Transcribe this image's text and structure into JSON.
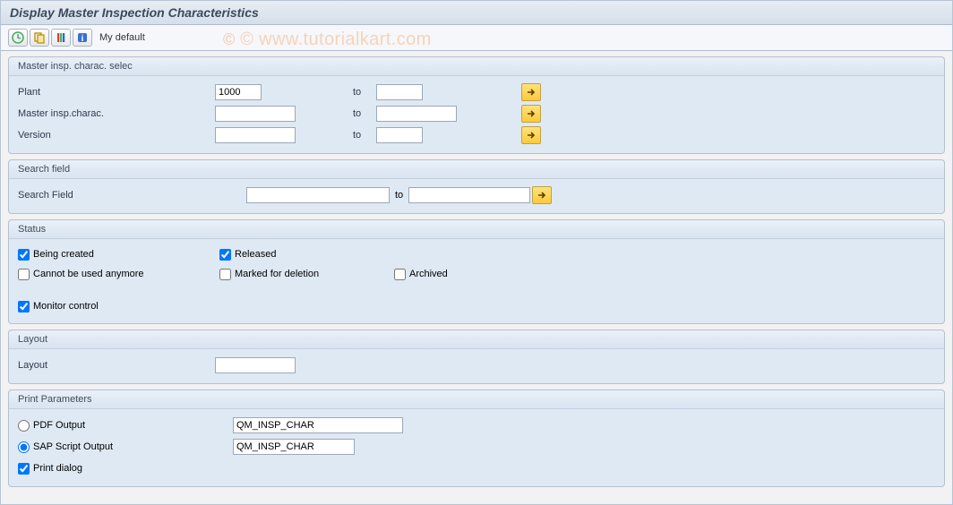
{
  "title": "Display Master Inspection Characteristics",
  "toolbar": {
    "my_default": "My default"
  },
  "watermark": "© www.tutorialkart.com",
  "group1": {
    "title": "Master insp. charac. selec",
    "plant_label": "Plant",
    "plant_value": "1000",
    "mic_label": "Master insp.charac.",
    "version_label": "Version",
    "to_label": "to"
  },
  "group2": {
    "title": "Search field",
    "search_label": "Search Field",
    "to_label": "to"
  },
  "group3": {
    "title": "Status",
    "being_created": "Being created",
    "released": "Released",
    "cannot_use": "Cannot be used anymore",
    "marked_deletion": "Marked for deletion",
    "archived": "Archived",
    "monitor": "Monitor control"
  },
  "group4": {
    "title": "Layout",
    "layout_label": "Layout"
  },
  "group5": {
    "title": "Print Parameters",
    "pdf_output": "PDF Output",
    "sap_script": "SAP Script Output",
    "print_dialog": "Print dialog",
    "pdf_value": "QM_INSP_CHAR",
    "sap_value": "QM_INSP_CHAR"
  }
}
